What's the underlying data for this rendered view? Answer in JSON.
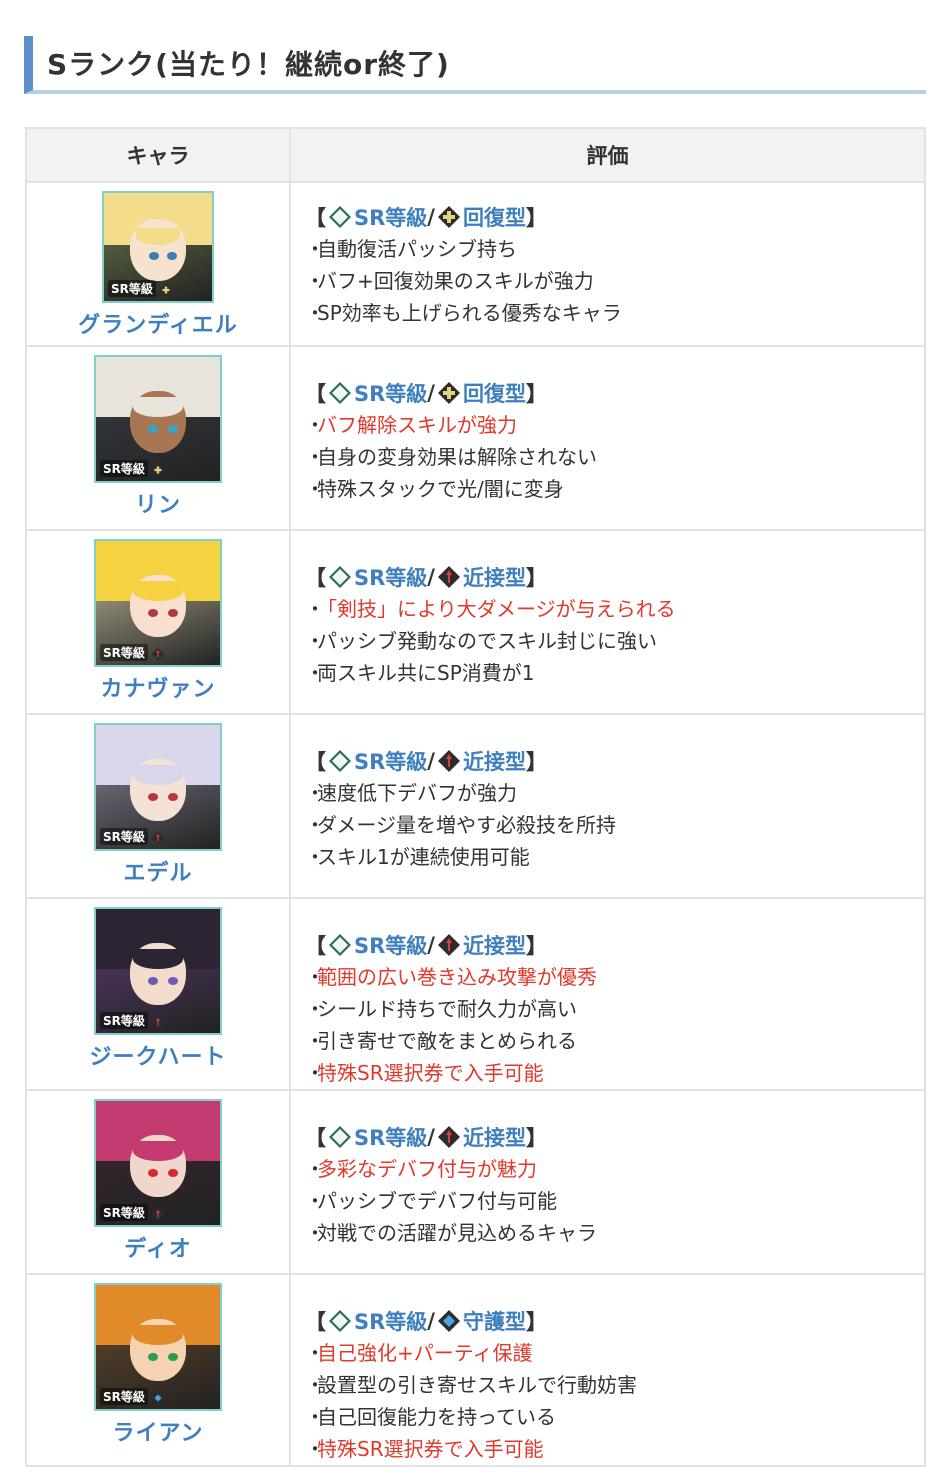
{
  "heading": "Sランク(当たり！継続or終了)",
  "table": {
    "headers": [
      "キャラ",
      "評価"
    ],
    "tag": {
      "open": "【",
      "rarity": "SR等級",
      "sep": "/",
      "close": "】"
    },
    "rows": [
      {
        "name": "グランディエル",
        "type": "回復型",
        "type_icon": "heal-type-icon",
        "palette": {
          "hair": "#f3dc8a",
          "skin": "#f7e2cf",
          "bg": "#6c7b4a",
          "eye": "#3a7fb0"
        },
        "points": [
          {
            "text": "自動復活パッシブ持ち",
            "red": false
          },
          {
            "text": "バフ+回復効果のスキルが強力",
            "red": false
          },
          {
            "text": "SP効率も上げられる優秀なキャラ",
            "red": false
          }
        ]
      },
      {
        "name": "リン",
        "type": "回復型",
        "type_icon": "heal-type-icon",
        "palette": {
          "hair": "#e8e4dc",
          "skin": "#a87653",
          "bg": "#3b3f49",
          "eye": "#36a6c8"
        },
        "points": [
          {
            "text": "バフ解除スキルが強力",
            "red": true
          },
          {
            "text": "自身の変身効果は解除されない",
            "red": false
          },
          {
            "text": "特殊スタックで光/闇に変身",
            "red": false
          }
        ]
      },
      {
        "name": "カナヴァン",
        "type": "近接型",
        "type_icon": "melee-type-icon",
        "palette": {
          "hair": "#f4d240",
          "skin": "#f8dfcf",
          "bg": "#c9c2a0",
          "eye": "#b03b3b"
        },
        "points": [
          {
            "text": "「剣技」により大ダメージが与えられる",
            "red": true
          },
          {
            "text": "パッシブ発動なのでスキル封じに強い",
            "red": false
          },
          {
            "text": "両スキル共にSP消費が1",
            "red": false
          }
        ]
      },
      {
        "name": "エデル",
        "type": "近接型",
        "type_icon": "melee-type-icon",
        "palette": {
          "hair": "#d9d6ec",
          "skin": "#f5e2d6",
          "bg": "#8c8a9e",
          "eye": "#b43a3a"
        },
        "points": [
          {
            "text": "速度低下デバフが強力",
            "red": false
          },
          {
            "text": "ダメージ量を増やす必殺技を所持",
            "red": false
          },
          {
            "text": "スキル1が連続使用可能",
            "red": false
          }
        ]
      },
      {
        "name": "ジークハート",
        "type": "近接型",
        "type_icon": "melee-type-icon",
        "palette": {
          "hair": "#2c2433",
          "skin": "#f3dccb",
          "bg": "#5d3c74",
          "eye": "#6e58b8"
        },
        "points": [
          {
            "text": "範囲の広い巻き込み攻撃が優秀",
            "red": true
          },
          {
            "text": "シールド持ちで耐久力が高い",
            "red": false
          },
          {
            "text": "引き寄せで敵をまとめられる",
            "red": false
          },
          {
            "text": "特殊SR選択券で入手可能",
            "red": true
          }
        ]
      },
      {
        "name": "ディオ",
        "type": "近接型",
        "type_icon": "melee-type-icon",
        "palette": {
          "hair": "#c23a70",
          "skin": "#f1d6cc",
          "bg": "#3a2733",
          "eye": "#d8292c"
        },
        "points": [
          {
            "text": "多彩なデバフ付与が魅力",
            "red": true
          },
          {
            "text": "パッシブでデバフ付与可能",
            "red": false
          },
          {
            "text": "対戦での活躍が見込めるキャラ",
            "red": false
          }
        ]
      },
      {
        "name": "ライアン",
        "type": "守護型",
        "type_icon": "guard-type-icon",
        "palette": {
          "hair": "#e08a2a",
          "skin": "#f4d2b2",
          "bg": "#6b4a2a",
          "eye": "#2f9a52"
        },
        "points": [
          {
            "text": "自己強化+パーティ保護",
            "red": true
          },
          {
            "text": "設置型の引き寄せスキルで行動妨害",
            "red": false
          },
          {
            "text": "自己回復能力を持っている",
            "red": false
          },
          {
            "text": "特殊SR選択券で入手可能",
            "red": true
          }
        ]
      }
    ]
  }
}
